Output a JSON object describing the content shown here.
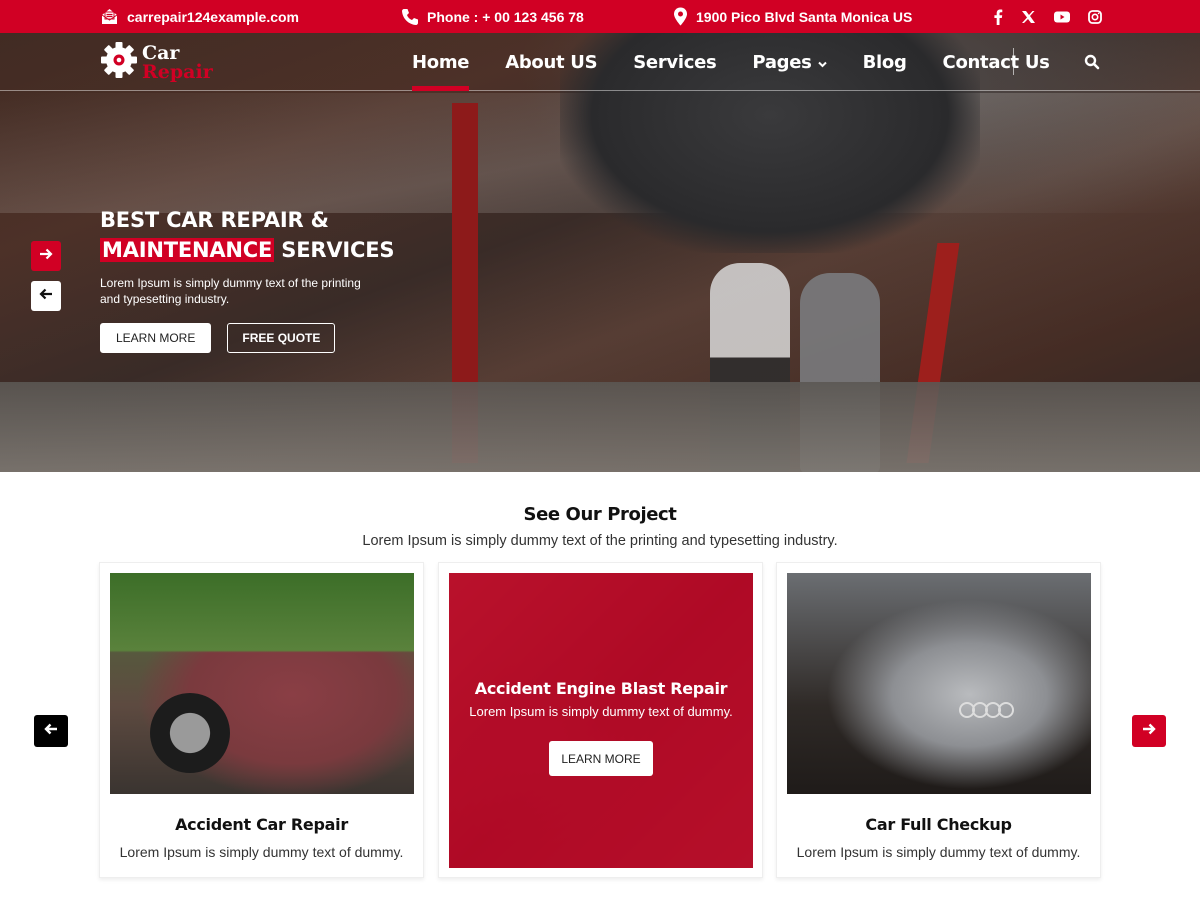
{
  "topbar": {
    "email": "carrepair124example.com",
    "phone": "Phone : + 00 123 456 78",
    "address": "1900 Pico Blvd Santa Monica US",
    "social": [
      "facebook",
      "x-twitter",
      "youtube",
      "instagram"
    ]
  },
  "logo": {
    "line1": "Car",
    "line2": "Repair"
  },
  "nav": {
    "items": [
      {
        "label": "Home",
        "active": true
      },
      {
        "label": "About US"
      },
      {
        "label": "Services"
      },
      {
        "label": "Pages",
        "dropdown": true
      },
      {
        "label": "Blog"
      },
      {
        "label": "Contact Us"
      }
    ]
  },
  "hero": {
    "title_line1": "BEST CAR REPAIR &",
    "title_highlight": "MAINTENANCE",
    "title_rest": "SERVICES",
    "description": "Lorem Ipsum is simply dummy text of the printing and typesetting industry.",
    "learn_more": "LEARN MORE",
    "free_quote": "FREE QUOTE"
  },
  "projects": {
    "title": "See Our Project",
    "subtitle": "Lorem Ipsum is simply dummy text of the printing and typesetting industry.",
    "cards": [
      {
        "title": "Accident Car Repair",
        "desc": "Lorem Ipsum is simply dummy text of dummy."
      },
      {
        "title": "Accident Engine Blast Repair",
        "desc": "Lorem Ipsum is simply dummy text of dummy.",
        "button": "LEARN MORE"
      },
      {
        "title": "Car Full Checkup",
        "desc": "Lorem Ipsum is simply dummy text of dummy."
      }
    ]
  },
  "colors": {
    "accent": "#d10024",
    "dark": "#000000",
    "white": "#ffffff"
  }
}
